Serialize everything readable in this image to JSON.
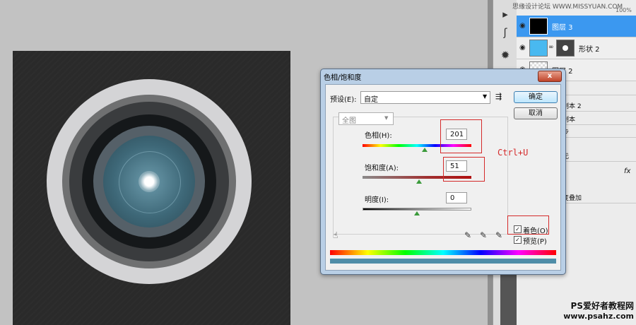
{
  "dialog": {
    "title": "色相/饱和度",
    "close_label": "x",
    "preset_label": "预设(E):",
    "preset_value": "自定",
    "channel_value": "全图",
    "hue_label": "色相(H):",
    "hue_value": "201",
    "saturation_label": "饱和度(A):",
    "saturation_value": "51",
    "lightness_label": "明度(I):",
    "lightness_value": "0",
    "ok_label": "确定",
    "cancel_label": "取消",
    "colorize_label": "着色(O)",
    "colorize_checked": true,
    "preview_label": "预览(P)",
    "preview_checked": true
  },
  "annotation": {
    "shortcut": "Ctrl+U"
  },
  "layers_panel": {
    "site_header": "思缘设计论坛 WWW.MISSYUAN.COM",
    "zoom": "100%",
    "layers": [
      {
        "name": "图层 3",
        "selected": true
      },
      {
        "name": "形状 2",
        "selected": false
      },
      {
        "name": "图层 2",
        "selected": false
      }
    ],
    "partial_rows": [
      "1",
      "制本 2",
      "制本",
      "步",
      "无",
      "变叠加"
    ],
    "fx_label": "fx"
  },
  "watermark": {
    "line1": "PS爱好者教程网",
    "line2": "www.psahz.com"
  },
  "colors": {
    "selected_layer": "#3b98f0",
    "canvas": "#2a2a2a",
    "annotation_red": "#d42a2a",
    "lens_core": "#3e6878"
  }
}
